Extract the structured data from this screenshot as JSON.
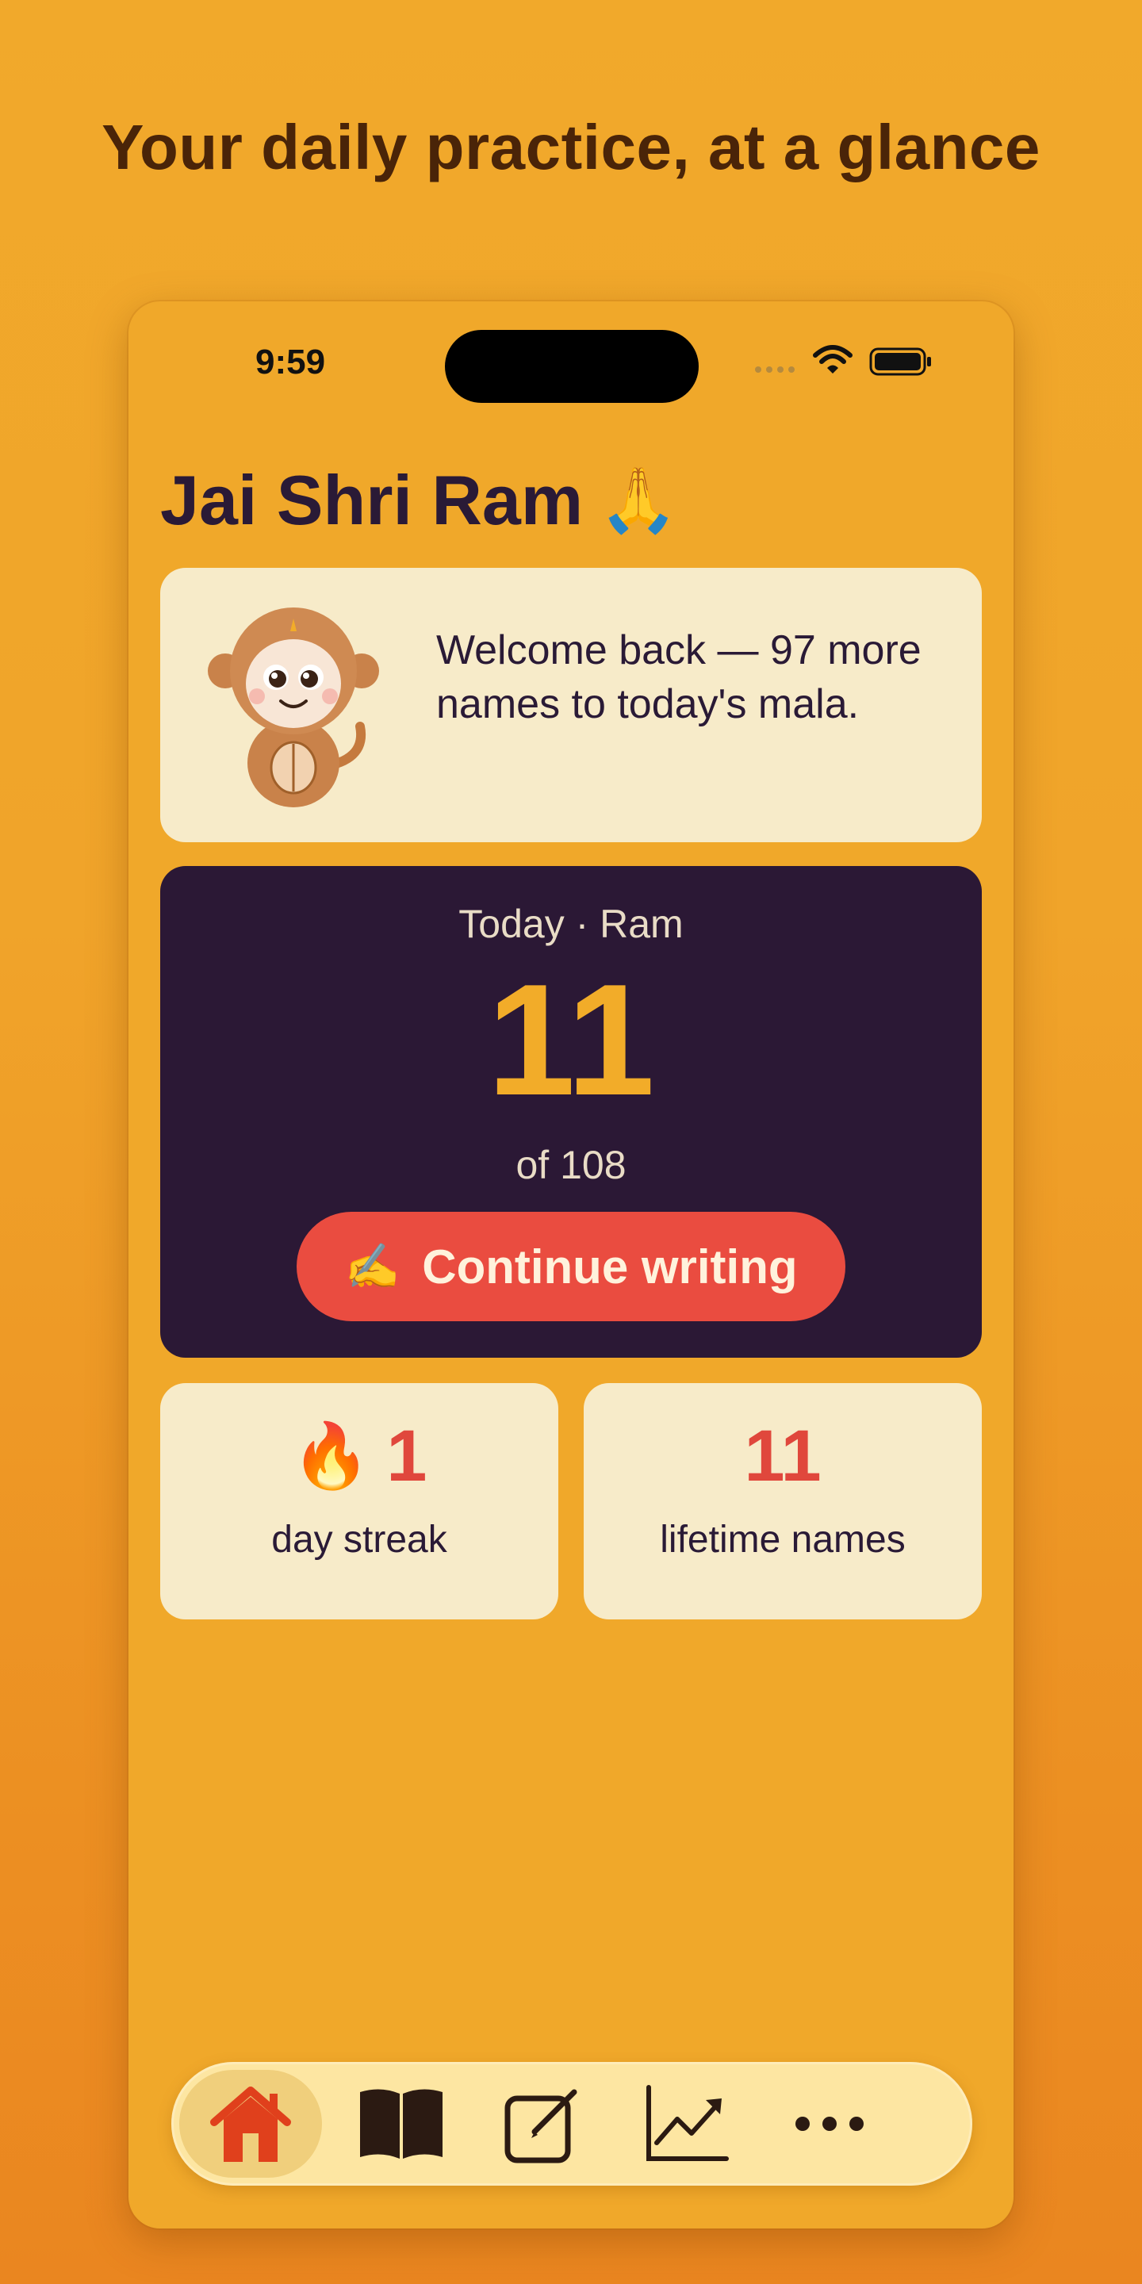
{
  "headline": "Your daily practice, at a glance",
  "status_bar": {
    "time": "9:59"
  },
  "greeting": {
    "text": "Jai Shri Ram",
    "emoji": "🙏"
  },
  "welcome_card": {
    "message": "Welcome back — 97 more names to today's mala.",
    "mascot_icon": "monkey-mascot-icon"
  },
  "today_card": {
    "label": "Today · Ram",
    "count": "11",
    "goal_text": "of 108",
    "button": {
      "emoji": "✍️",
      "label": "Continue writing"
    }
  },
  "stats": {
    "streak": {
      "emoji": "🔥",
      "value": "1",
      "label": "day streak"
    },
    "lifetime": {
      "value": "11",
      "label": "lifetime names"
    }
  },
  "tab_bar": {
    "active": "home",
    "items": [
      {
        "name": "home",
        "icon": "home-icon"
      },
      {
        "name": "read",
        "icon": "book-icon"
      },
      {
        "name": "write",
        "icon": "edit-icon"
      },
      {
        "name": "progress",
        "icon": "chart-icon"
      },
      {
        "name": "more",
        "icon": "more-icon"
      }
    ]
  },
  "colors": {
    "background": "#f1a92b",
    "headline": "#4a2408",
    "card_light": "#f7ebc9",
    "card_dark": "#2b1835",
    "accent_orange": "#f2ac29",
    "accent_red": "#ea4c40",
    "text_dark": "#2a1a36"
  }
}
